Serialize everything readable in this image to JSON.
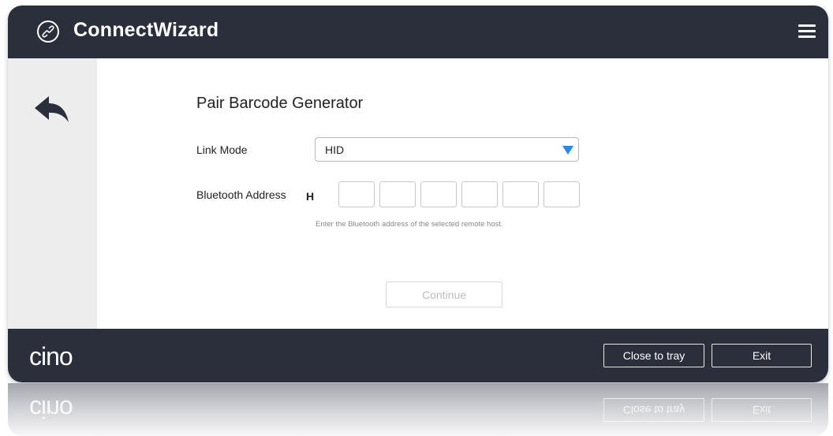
{
  "app": {
    "title": "ConnectWizard",
    "logo_icon": "link-icon",
    "menu_icon": "hamburger-menu-icon"
  },
  "sidebar": {
    "back_icon": "back-arrow-icon"
  },
  "main": {
    "title": "Pair Barcode Generator",
    "link_mode": {
      "label": "Link Mode",
      "value": "HID",
      "arrow_color": "#2e86de"
    },
    "bluetooth": {
      "label": "Bluetooth Address",
      "prefix": "H",
      "octets": [
        "",
        "",
        "",
        "",
        "",
        ""
      ],
      "hint": "Enter the Bluetooth address of the selected remote host."
    },
    "continue_label": "Continue"
  },
  "footer": {
    "brand": "cino",
    "close_to_tray_label": "Close to tray",
    "exit_label": "Exit"
  },
  "colors": {
    "header_bg": "#2b2e3b",
    "sidebar_bg": "#ededed"
  }
}
